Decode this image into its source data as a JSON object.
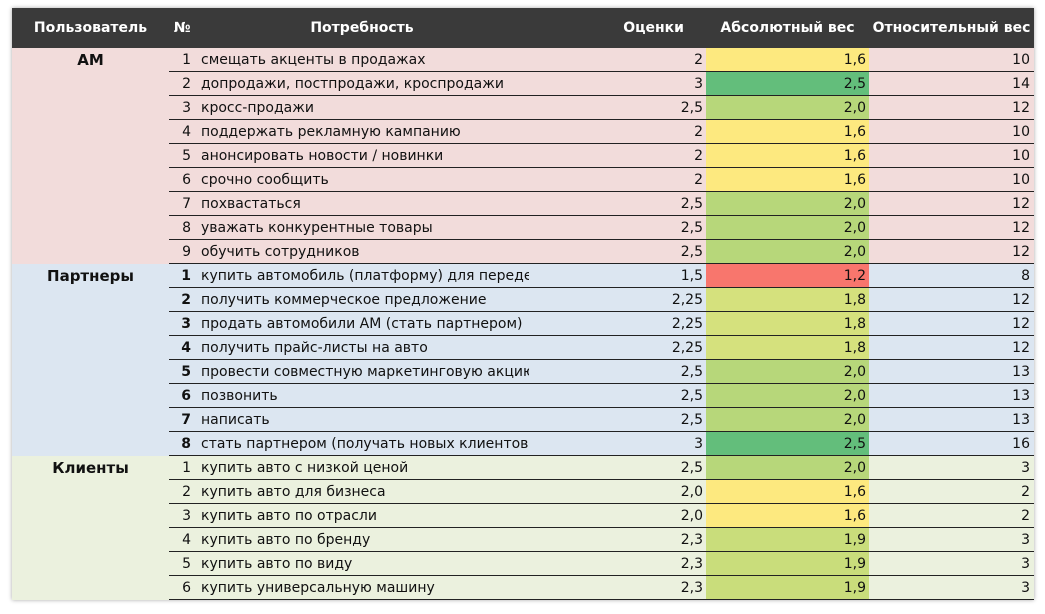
{
  "columns": {
    "user": "Пользователь",
    "num": "№",
    "need": "Потребность",
    "score": "Оценки",
    "abs_weight": "Абсолютный вес",
    "rel_weight": "Относительный вес"
  },
  "colors": {
    "header_bg": "#3a3a3a",
    "am_bg": "#f2dcdb",
    "partners_bg": "#dce6f1",
    "clients_bg": "#ebf1de",
    "heat_red": "#f8766d",
    "heat_yellow": "#fde97f",
    "heat_lightgreen": "#b7d77a",
    "heat_green": "#63be7b"
  },
  "groups": [
    {
      "label": "АМ",
      "bg": "#f2dcdb",
      "rows": [
        {
          "num": "1",
          "need": "смещать акценты в продажах",
          "score": "2",
          "abs": "1,6",
          "abs_color": "#fde97f",
          "rel": "10"
        },
        {
          "num": "2",
          "need": "допродажи, постпродажи, кроспродажи",
          "score": "3",
          "abs": "2,5",
          "abs_color": "#63be7b",
          "rel": "14"
        },
        {
          "num": "3",
          "need": "кросс-продажи",
          "score": "2,5",
          "abs": "2,0",
          "abs_color": "#b7d77a",
          "rel": "12"
        },
        {
          "num": "4",
          "need": "поддержать рекламную кампанию",
          "score": "2",
          "abs": "1,6",
          "abs_color": "#fde97f",
          "rel": "10"
        },
        {
          "num": "5",
          "need": "анонсировать новости / новинки",
          "score": "2",
          "abs": "1,6",
          "abs_color": "#fde97f",
          "rel": "10"
        },
        {
          "num": "6",
          "need": "срочно сообщить",
          "score": "2",
          "abs": "1,6",
          "abs_color": "#fde97f",
          "rel": "10"
        },
        {
          "num": "7",
          "need": "похвастаться",
          "score": "2,5",
          "abs": "2,0",
          "abs_color": "#b7d77a",
          "rel": "12"
        },
        {
          "num": "8",
          "need": "уважать конкурентные товары",
          "score": "2,5",
          "abs": "2,0",
          "abs_color": "#b7d77a",
          "rel": "12"
        },
        {
          "num": "9",
          "need": "обучить сотрудников",
          "score": "2,5",
          "abs": "2,0",
          "abs_color": "#b7d77a",
          "rel": "12"
        }
      ]
    },
    {
      "label": "Партнеры",
      "bg": "#dce6f1",
      "rows": [
        {
          "num": "1",
          "need": "купить автомобиль (платформу) для переделок",
          "score": "1,5",
          "abs": "1,2",
          "abs_color": "#f8766d",
          "rel": "8"
        },
        {
          "num": "2",
          "need": "получить коммерческое предложение",
          "score": "2,25",
          "abs": "1,8",
          "abs_color": "#d5e17d",
          "rel": "12"
        },
        {
          "num": "3",
          "need": "продать автомобили АМ (стать партнером)",
          "score": "2,25",
          "abs": "1,8",
          "abs_color": "#d5e17d",
          "rel": "12"
        },
        {
          "num": "4",
          "need": "получить прайс-листы на авто",
          "score": "2,25",
          "abs": "1,8",
          "abs_color": "#d5e17d",
          "rel": "12"
        },
        {
          "num": "5",
          "need": "провести совместную маркетинговую акцию",
          "score": "2,5",
          "abs": "2,0",
          "abs_color": "#b7d77a",
          "rel": "13"
        },
        {
          "num": "6",
          "need": "позвонить",
          "score": "2,5",
          "abs": "2,0",
          "abs_color": "#b7d77a",
          "rel": "13"
        },
        {
          "num": "7",
          "need": "написать",
          "score": "2,5",
          "abs": "2,0",
          "abs_color": "#b7d77a",
          "rel": "13"
        },
        {
          "num": "8",
          "need": "стать партнером (получать новых клиентов)",
          "score": "3",
          "abs": "2,5",
          "abs_color": "#63be7b",
          "rel": "16"
        }
      ]
    },
    {
      "label": "Клиенты",
      "bg": "#ebf1de",
      "rows": [
        {
          "num": "1",
          "need": "купить авто с низкой ценой",
          "score": "2,5",
          "abs": "2,0",
          "abs_color": "#b7d77a",
          "rel": "3"
        },
        {
          "num": "2",
          "need": "купить авто для бизнеса",
          "score": "2,0",
          "abs": "1,6",
          "abs_color": "#fde97f",
          "rel": "2"
        },
        {
          "num": "3",
          "need": "купить авто по отрасли",
          "score": "2,0",
          "abs": "1,6",
          "abs_color": "#fde97f",
          "rel": "2"
        },
        {
          "num": "4",
          "need": "купить авто по бренду",
          "score": "2,3",
          "abs": "1,9",
          "abs_color": "#c9dd7b",
          "rel": "3"
        },
        {
          "num": "5",
          "need": "купить авто по виду",
          "score": "2,3",
          "abs": "1,9",
          "abs_color": "#c9dd7b",
          "rel": "3"
        },
        {
          "num": "6",
          "need": "купить универсальную машину",
          "score": "2,3",
          "abs": "1,9",
          "abs_color": "#c9dd7b",
          "rel": "3"
        }
      ]
    }
  ]
}
